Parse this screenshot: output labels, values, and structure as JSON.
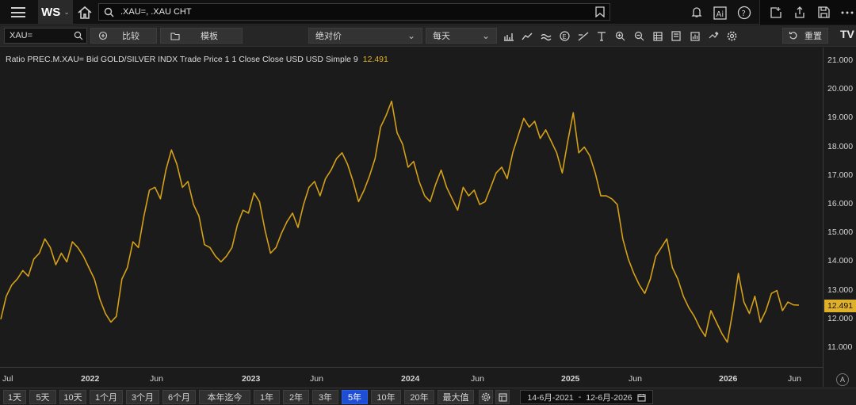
{
  "topbar": {
    "app_label": "WS",
    "search_value": ".XAU=, .XAU CHT"
  },
  "toolbar": {
    "ric_value": "XAU=",
    "compare_label": "比较",
    "template_label": "模板",
    "price_type": "绝对价",
    "interval": "每天",
    "reset_label": "重置"
  },
  "legend": {
    "text": "Ratio PREC.M.XAU= Bid GOLD/SILVER INDX Trade Price 1 1 Close Close USD USD Simple 9",
    "value": "12.491"
  },
  "colors": {
    "line": "#d4a017",
    "accent_blue": "#1d4fd6"
  },
  "chart_data": {
    "type": "line",
    "y_ticks": [
      "21.000",
      "20.000",
      "19.000",
      "18.000",
      "17.000",
      "16.000",
      "15.000",
      "14.000",
      "13.000",
      "12.000",
      "11.000"
    ],
    "last_value_label": "12.491",
    "x_ticks": [
      {
        "label": "Jul",
        "bold": false
      },
      {
        "label": "2022",
        "bold": true
      },
      {
        "label": "Jun",
        "bold": false
      },
      {
        "label": "2023",
        "bold": true
      },
      {
        "label": "Jun",
        "bold": false
      },
      {
        "label": "2024",
        "bold": true
      },
      {
        "label": "Jun",
        "bold": false
      },
      {
        "label": "2025",
        "bold": true
      },
      {
        "label": "Jun",
        "bold": false
      },
      {
        "label": "2026",
        "bold": true
      },
      {
        "label": "Jun",
        "bold": false
      }
    ],
    "ylim": [
      10.5,
      21.4
    ],
    "series": [
      {
        "values": [
          12.0,
          12.8,
          13.2,
          13.4,
          13.7,
          13.5,
          14.1,
          14.3,
          14.8,
          14.5,
          13.9,
          14.3,
          14.0,
          14.7,
          14.5,
          14.2,
          13.8,
          13.4,
          12.7,
          12.2,
          11.9,
          12.1,
          13.4,
          13.8,
          14.7,
          14.5,
          15.6,
          16.5,
          16.6,
          16.2,
          17.2,
          17.9,
          17.4,
          16.6,
          16.8,
          16.0,
          15.6,
          14.6,
          14.5,
          14.2,
          14.0,
          14.2,
          14.5,
          15.3,
          15.8,
          15.7,
          16.4,
          16.1,
          15.1,
          14.3,
          14.5,
          15.0,
          15.4,
          15.7,
          15.2,
          16.0,
          16.6,
          16.8,
          16.3,
          16.9,
          17.2,
          17.6,
          17.8,
          17.4,
          16.8,
          16.1,
          16.5,
          17.0,
          17.6,
          18.7,
          19.1,
          19.6,
          18.5,
          18.1,
          17.3,
          17.5,
          16.8,
          16.3,
          16.1,
          16.7,
          17.2,
          16.6,
          16.2,
          15.8,
          16.6,
          16.3,
          16.5,
          16.0,
          16.1,
          16.6,
          17.1,
          17.3,
          16.9,
          17.8,
          18.4,
          19.0,
          18.7,
          18.9,
          18.3,
          18.6,
          18.2,
          17.8,
          17.1,
          18.2,
          19.2,
          17.8,
          18.0,
          17.7,
          17.1,
          16.3,
          16.3,
          16.2,
          16.0,
          14.8,
          14.1,
          13.6,
          13.2,
          12.9,
          13.4,
          14.2,
          14.5,
          14.8,
          13.8,
          13.4,
          12.8,
          12.4,
          12.1,
          11.7,
          11.4,
          12.3,
          11.9,
          11.5,
          11.2,
          12.3,
          13.6,
          12.6,
          12.2,
          12.8,
          11.9,
          12.3,
          12.9,
          13.0,
          12.3,
          12.6,
          12.5,
          12.491
        ]
      }
    ]
  },
  "axis_a_label": "A",
  "range_buttons": [
    "1天",
    "5天",
    "10天",
    "1个月",
    "3个月",
    "6个月",
    "本年迄今",
    "1年",
    "2年",
    "3年",
    "5年",
    "10年",
    "20年",
    "最大值"
  ],
  "date_range": {
    "from": "14-6月-2021",
    "to": "12-6月-2026"
  }
}
